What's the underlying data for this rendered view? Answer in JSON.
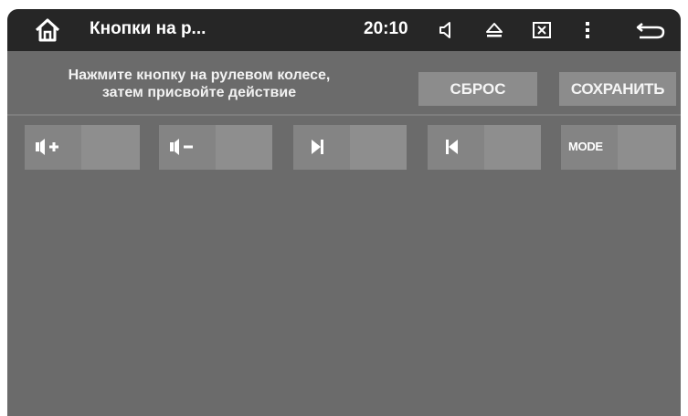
{
  "statusbar": {
    "title": "Кнопки на р...",
    "time": "20:10",
    "icons": [
      "home-icon",
      "volume-icon",
      "eject-icon",
      "screenshot-icon",
      "more-vert-icon",
      "back-icon"
    ]
  },
  "header": {
    "instruction_line1": "Нажмите кнопку на рулевом колесе,",
    "instruction_line2": "затем присвойте действие",
    "reset_label": "СБРОС",
    "save_label": "СОХРАНИТЬ"
  },
  "keys": [
    {
      "icon": "volume-up-icon"
    },
    {
      "icon": "volume-down-icon"
    },
    {
      "icon": "next-track-icon"
    },
    {
      "icon": "previous-track-icon"
    },
    {
      "label": "MODE"
    }
  ],
  "colors": {
    "statusbar": "#262626",
    "background": "#6b6b6b",
    "button": "#8c8c8c"
  }
}
